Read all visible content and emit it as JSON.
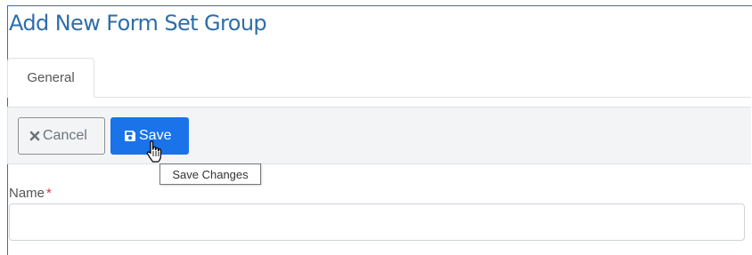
{
  "page": {
    "title": "Add New Form Set Group"
  },
  "tabs": [
    {
      "label": "General",
      "active": true
    }
  ],
  "toolbar": {
    "cancel_label": "Cancel",
    "cancel_icon": "times-icon",
    "save_label": "Save",
    "save_icon": "floppy-disk-icon",
    "save_tooltip": "Save Changes"
  },
  "form": {
    "name_label": "Name",
    "name_required_marker": "*",
    "name_value": "",
    "name_placeholder": ""
  },
  "colors": {
    "title": "#2f6ea8",
    "primary": "#1a73e8",
    "required": "#dc3545",
    "toolbar_bg": "#f3f4f6"
  }
}
